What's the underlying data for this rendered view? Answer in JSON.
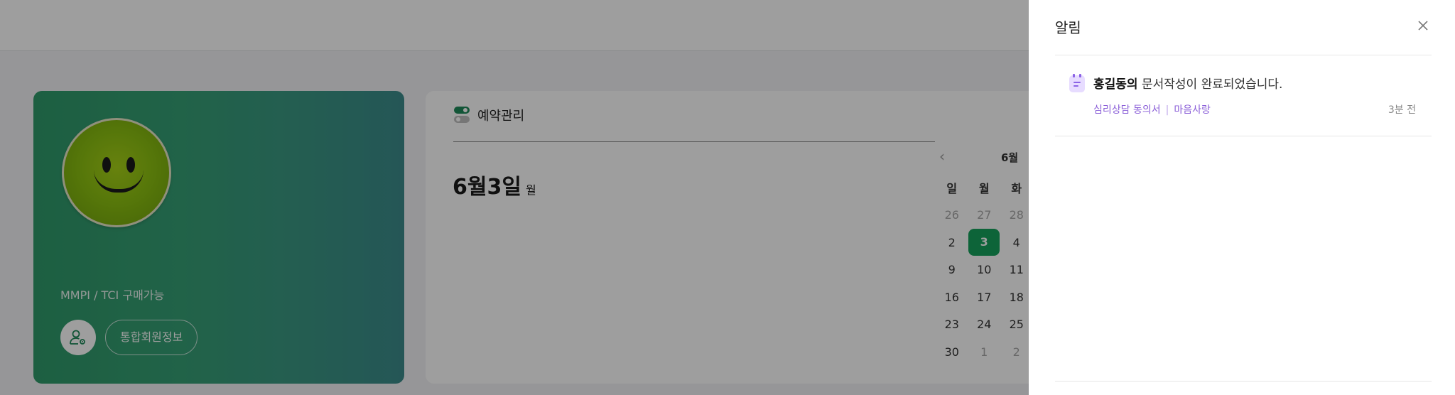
{
  "reserve": {
    "title": "예약관리",
    "date": "6월3일",
    "day_of_week": "월"
  },
  "profile": {
    "subtitle": "MMPI / TCI 구매가능",
    "member_button": "통합회원정보"
  },
  "calendar": {
    "month": "6월",
    "weekdays": [
      "일",
      "월",
      "화"
    ],
    "weeks": [
      [
        {
          "d": "26",
          "muted": true
        },
        {
          "d": "27",
          "muted": true
        },
        {
          "d": "28",
          "muted": true
        }
      ],
      [
        {
          "d": "2"
        },
        {
          "d": "3",
          "selected": true
        },
        {
          "d": "4"
        }
      ],
      [
        {
          "d": "9"
        },
        {
          "d": "10"
        },
        {
          "d": "11"
        }
      ],
      [
        {
          "d": "16"
        },
        {
          "d": "17"
        },
        {
          "d": "18"
        }
      ],
      [
        {
          "d": "23"
        },
        {
          "d": "24"
        },
        {
          "d": "25"
        }
      ],
      [
        {
          "d": "30"
        },
        {
          "d": "1",
          "muted": true
        },
        {
          "d": "2",
          "muted": true
        }
      ]
    ]
  },
  "drawer": {
    "title": "알림",
    "close_icon": "close-icon",
    "notifications": [
      {
        "icon": "calendar-icon",
        "name": "홍길동의",
        "message": "문서작성이 완료되었습니다.",
        "tag1": "심리상담 동의서",
        "separator": "|",
        "tag2": "마음사랑",
        "time": "3분 전"
      }
    ]
  },
  "colors": {
    "accent_green": "#15a25c",
    "profile_gradient_start": "#2f9a6a",
    "profile_gradient_end": "#3c8c8c",
    "notification_purple": "#8b5fd8"
  }
}
